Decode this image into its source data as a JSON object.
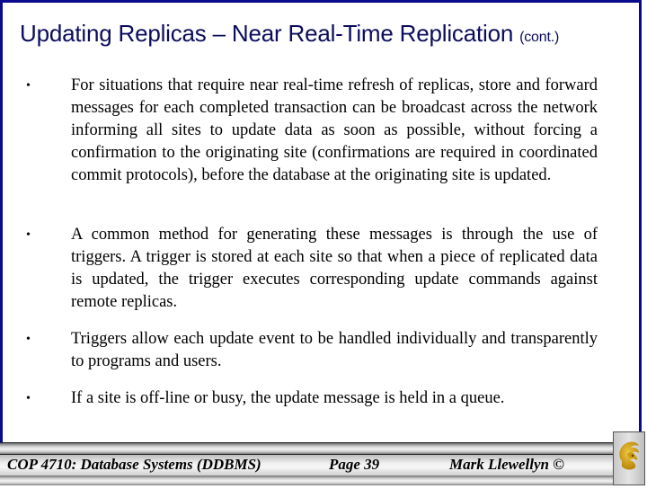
{
  "slide": {
    "title": "Updating Replicas – Near Real-Time Replication",
    "title_suffix": "(cont.)",
    "bullets": [
      {
        "text": "For situations that require near real-time refresh of replicas, store and forward messages for each completed transaction can be broadcast across the network informing all sites to update data as soon as possible, without forcing a confirmation to the originating site (confirmations are required in coordinated commit protocols), before the database at the originating site is updated."
      },
      {
        "text": "A common method for generating these messages is through the use of triggers.  A trigger is stored at each site so that when a piece of replicated data is updated, the trigger executes corresponding update commands against remote replicas."
      },
      {
        "text": "Triggers allow each update event to be handled individually and transparently to programs and users."
      },
      {
        "text": "If a site is off-line or busy, the update message is held in a queue."
      }
    ],
    "bullet_glyph": "•"
  },
  "footer": {
    "course": "COP 4710: Database Systems  (DDBMS)",
    "page": "Page 39",
    "author": "Mark Llewellyn ©",
    "logo_icon": "pegasus-logo-icon",
    "logo_color": "#d4a20a"
  },
  "colors": {
    "border": "#0a0a8c",
    "title": "#0c0c5e"
  }
}
